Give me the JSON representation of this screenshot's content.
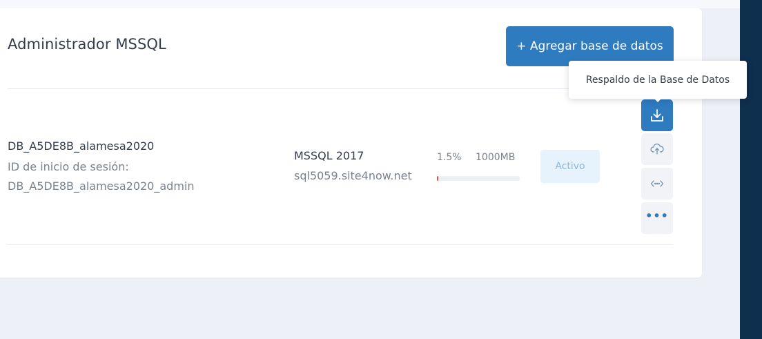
{
  "header": {
    "title": "Administrador MSSQL",
    "add_button_label": "+ Agregar base de datos"
  },
  "tooltip": {
    "text": "Respaldo de la Base de Datos"
  },
  "database": {
    "name": "DB_A5DE8B_alamesa2020",
    "login_label": "ID de inicio de sesión:",
    "login_value": "DB_A5DE8B_alamesa2020_admin",
    "server_version": "MSSQL 2017",
    "server_host": "sql5059.site4now.net",
    "usage_percent": "1.5%",
    "usage_fraction": 0.015,
    "quota": "1000MB",
    "status": "Activo"
  },
  "actions": [
    {
      "name": "backup-button",
      "icon": "download-icon"
    },
    {
      "name": "restore-button",
      "icon": "cloud-upload-icon"
    },
    {
      "name": "connection-button",
      "icon": "code-icon"
    },
    {
      "name": "more-options-button",
      "icon": "ellipsis-icon",
      "label": "•••"
    }
  ],
  "colors": {
    "primary": "#2f7bc0",
    "sidebar": "#0f2f4f",
    "usage_bar": "#d9534f",
    "status_bg": "#e6f3fc"
  }
}
